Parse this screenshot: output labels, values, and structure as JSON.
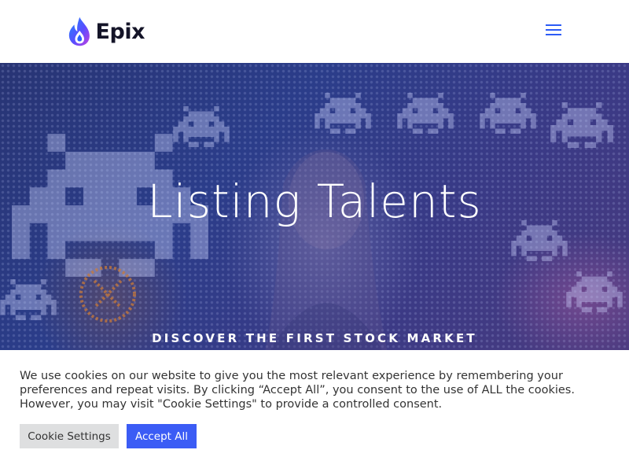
{
  "header": {
    "logo_text": "Epix",
    "menu_icon": "hamburger-menu-icon",
    "accent_color": "#2d5cf6"
  },
  "hero": {
    "title": "Listing Talents",
    "subtitle": "DISCOVER THE FIRST STOCK MARKET"
  },
  "cookie_banner": {
    "message": "We use cookies on our website to give you the most relevant experience by remembering your preferences and repeat visits. By clicking “Accept All”, you consent to the use of ALL the cookies. However, you may visit \"Cookie Settings\" to provide a controlled consent.",
    "settings_label": "Cookie Settings",
    "accept_label": "Accept All",
    "accept_color": "#3b5cf5"
  }
}
